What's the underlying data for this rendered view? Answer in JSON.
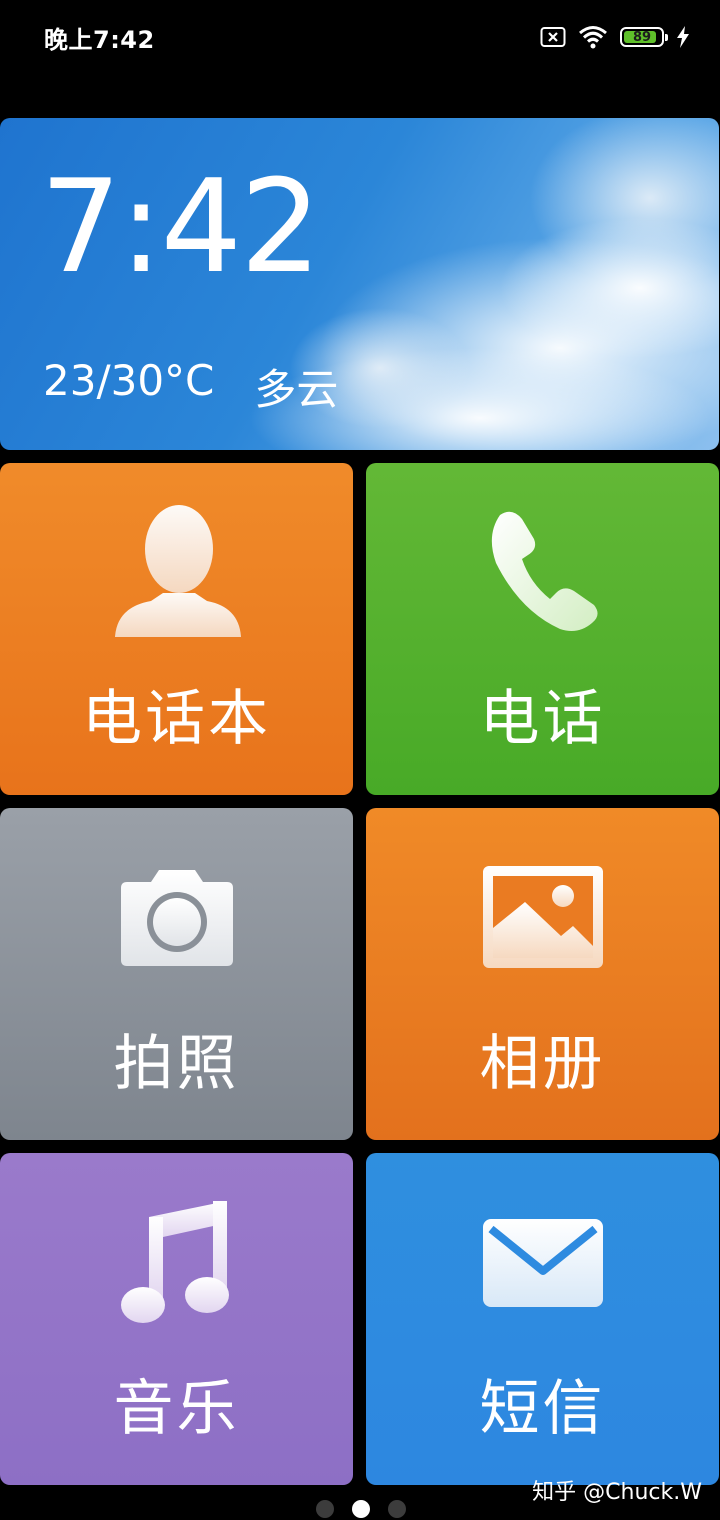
{
  "status_bar": {
    "time": "晚上7:42",
    "battery_level": "89",
    "icons": [
      "sim-x-icon",
      "wifi-icon",
      "battery-icon",
      "charging-bolt-icon"
    ]
  },
  "weather_card": {
    "clock": "7:42",
    "temperature": "23/30°C",
    "condition": "多云"
  },
  "tiles": [
    {
      "label": "电话本",
      "icon": "contacts-person-icon",
      "color": "#ee821f"
    },
    {
      "label": "电话",
      "icon": "phone-handset-icon",
      "color": "#52b02c"
    },
    {
      "label": "拍照",
      "icon": "camera-icon",
      "color": "#8a9098"
    },
    {
      "label": "相册",
      "icon": "gallery-image-icon",
      "color": "#ea7b22"
    },
    {
      "label": "音乐",
      "icon": "music-note-icon",
      "color": "#9473c8"
    },
    {
      "label": "短信",
      "icon": "envelope-icon",
      "color": "#2e8be0"
    }
  ],
  "pager": {
    "pages": 3,
    "active_index": 1
  },
  "watermark": "知乎 @Chuck.W"
}
